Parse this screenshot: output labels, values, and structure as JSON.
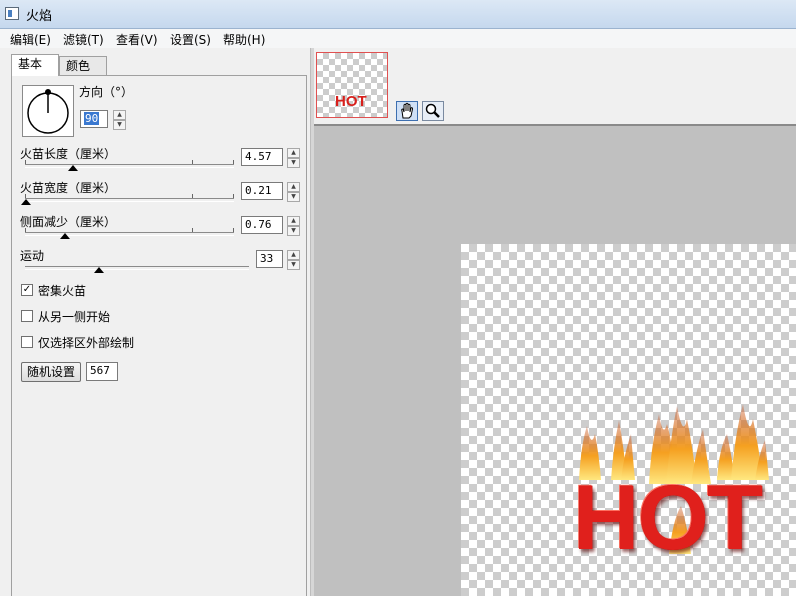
{
  "window": {
    "title": "火焰"
  },
  "menu": [
    {
      "label": "编辑(E)"
    },
    {
      "label": "滤镜(T)"
    },
    {
      "label": "查看(V)"
    },
    {
      "label": "设置(S)"
    },
    {
      "label": "帮助(H)"
    }
  ],
  "tabs": {
    "basic": "基本",
    "color": "颜色"
  },
  "direction": {
    "label": "方向（°）",
    "value": "90"
  },
  "flame_length": {
    "label": "火苗长度（厘米）",
    "value": "4.57"
  },
  "flame_width": {
    "label": "火苗宽度（厘米）",
    "value": "0.21"
  },
  "side_reduce": {
    "label": "侧面减少（厘米）",
    "value": "0.76"
  },
  "motion": {
    "label": "运动",
    "value": "33"
  },
  "options": {
    "dense": {
      "label": "密集火苗",
      "checked": true
    },
    "other_side": {
      "label": "从另一侧开始",
      "checked": false
    },
    "outside_only": {
      "label": "仅选择区外部绘制",
      "checked": false
    }
  },
  "random": {
    "label": "随机设置",
    "seed": "567"
  },
  "preview": {
    "thumbnail_text": "HOT",
    "canvas_text": "HOT"
  },
  "icons": {
    "hand": "hand-tool-icon",
    "zoom": "magnifier-icon"
  },
  "colors": {
    "text_red": "#e0201c",
    "flame_orange": "#f5a020",
    "flame_yellow": "#ffe060"
  }
}
